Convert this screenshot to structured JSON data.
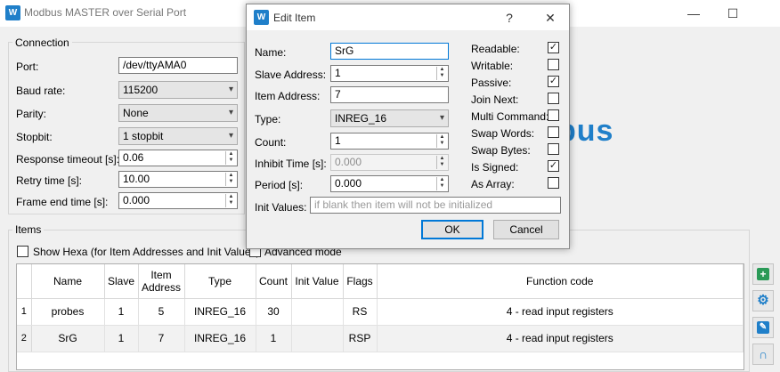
{
  "window": {
    "title": "Modbus MASTER over Serial Port",
    "minimize_glyph": "—",
    "maximize_glyph": "☐"
  },
  "icons": {
    "app": "modbus-logo-icon",
    "add": "add-plus-icon",
    "settings": "gear-icon",
    "edit": "edit-icon",
    "connect": "magnet-icon"
  },
  "colors": {
    "accent": "#1f7fc9",
    "green_button": "#2a9a57",
    "blue_button": "#1f7fc9",
    "dialog_focus": "#0078d7"
  },
  "connection": {
    "title": "Connection",
    "port_label": "Port:",
    "port_value": "/dev/ttyAMA0",
    "baud_label": "Baud rate:",
    "baud_value": "115200",
    "parity_label": "Parity:",
    "parity_value": "None",
    "stopbit_label": "Stopbit:",
    "stopbit_value": "1 stopbit",
    "response_timeout_label": "Response timeout [s]:",
    "response_timeout_value": "0.06",
    "retry_time_label": "Retry time [s]:",
    "retry_time_value": "10.00",
    "frame_end_label": "Frame end time [s]:",
    "frame_end_value": "0.000"
  },
  "brand": {
    "logo_text": "bus"
  },
  "items": {
    "title": "Items",
    "show_hexa_label": "Show Hexa (for Item Addresses and Init Values)",
    "show_hexa_checked": false,
    "advanced_mode_label": "Advanced mode",
    "advanced_mode_checked": false,
    "columns": [
      "Name",
      "Slave",
      "Item Address",
      "Type",
      "Count",
      "Init Value",
      "Flags",
      "Function code"
    ],
    "rows": [
      {
        "index": "1",
        "name": "probes",
        "slave": "1",
        "address": "5",
        "type": "INREG_16",
        "count": "30",
        "init": "",
        "flags": "RS",
        "function": "4 - read input registers"
      },
      {
        "index": "2",
        "name": "SrG",
        "slave": "1",
        "address": "7",
        "type": "INREG_16",
        "count": "1",
        "init": "",
        "flags": "RSP",
        "function": "4 - read input registers"
      }
    ]
  },
  "dialog": {
    "title": "Edit Item",
    "help_glyph": "?",
    "close_glyph": "✕",
    "name_label": "Name:",
    "name_value": "SrG",
    "slave_label": "Slave Address:",
    "slave_value": "1",
    "item_address_label": "Item Address:",
    "item_address_value": "7",
    "type_label": "Type:",
    "type_value": "INREG_16",
    "count_label": "Count:",
    "count_value": "1",
    "inhibit_label": "Inhibit Time [s]:",
    "inhibit_value": "0.000",
    "period_label": "Period [s]:",
    "period_value": "0.000",
    "init_label": "Init Values:",
    "init_placeholder": "if blank then item will not be initialized",
    "ok_label": "OK",
    "cancel_label": "Cancel",
    "flags": [
      {
        "label": "Readable:",
        "checked": true
      },
      {
        "label": "Writable:",
        "checked": false
      },
      {
        "label": "Passive:",
        "checked": true
      },
      {
        "label": "Join Next:",
        "checked": false
      },
      {
        "label": "Multi Command:",
        "checked": false
      },
      {
        "label": "Swap Words:",
        "checked": false
      },
      {
        "label": "Swap Bytes:",
        "checked": false
      },
      {
        "label": "Is Signed:",
        "checked": true
      },
      {
        "label": "As Array:",
        "checked": false
      }
    ]
  }
}
